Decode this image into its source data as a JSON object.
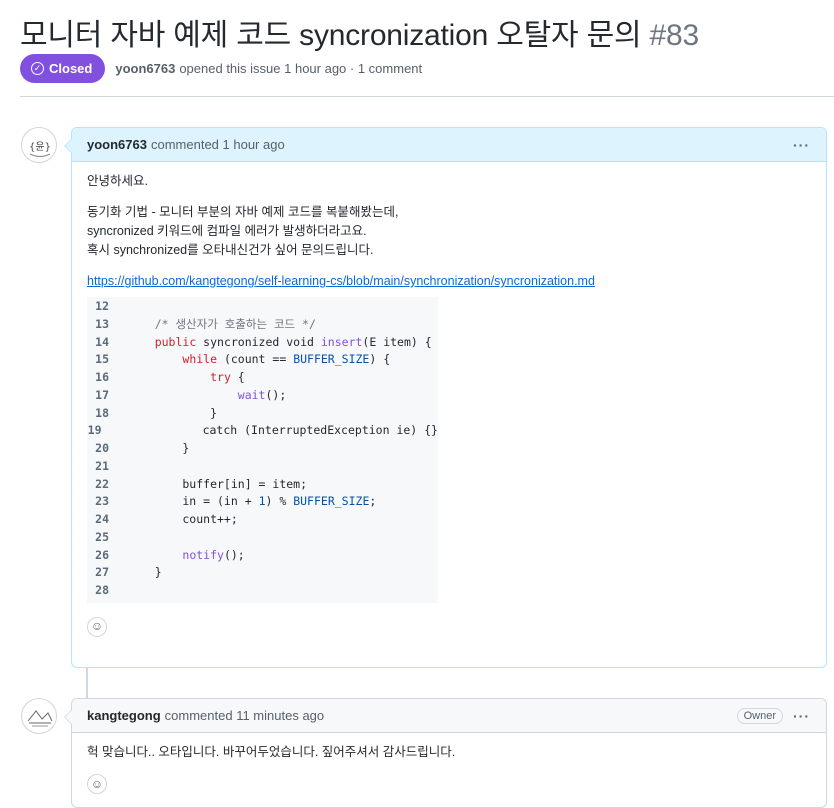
{
  "issue": {
    "title": "모니터 자바 예제 코드 syncronization 오탈자 문의",
    "number": "#83",
    "status": "Closed",
    "author": "yoon6763",
    "opened_text": "opened this issue 1 hour ago · 1 comment"
  },
  "comments": [
    {
      "author": "yoon6763",
      "time_text": "commented 1 hour ago",
      "body": {
        "greeting": "안녕하세요.",
        "para_lines": [
          "동기화 기법 - 모니터 부분의 자바 예제 코드를 복붙해봤는데,",
          "syncronized 키워드에 컴파일 에러가 발생하더라고요.",
          "혹시 synchronized를 오타내신건가 싶어 문의드립니다."
        ],
        "link": "https://github.com/kangtegong/self-learning-cs/blob/main/synchronization/syncronization.md",
        "code_lines": [
          {
            "n": "12",
            "t": ""
          },
          {
            "n": "13",
            "t": "    /* 생산자가 호출하는 코드 */"
          },
          {
            "n": "14",
            "t": "    public syncronized void insert(E item) {"
          },
          {
            "n": "15",
            "t": "        while (count == BUFFER_SIZE) {"
          },
          {
            "n": "16",
            "t": "            try {"
          },
          {
            "n": "17",
            "t": "                wait();"
          },
          {
            "n": "18",
            "t": "            }"
          },
          {
            "n": "19",
            "t": "            catch (InterruptedException ie) {}"
          },
          {
            "n": "20",
            "t": "        }"
          },
          {
            "n": "21",
            "t": ""
          },
          {
            "n": "22",
            "t": "        buffer[in] = item;"
          },
          {
            "n": "23",
            "t": "        in = (in + 1) % BUFFER_SIZE;"
          },
          {
            "n": "24",
            "t": "        count++;"
          },
          {
            "n": "25",
            "t": ""
          },
          {
            "n": "26",
            "t": "        notify();"
          },
          {
            "n": "27",
            "t": "    }"
          },
          {
            "n": "28",
            "t": ""
          }
        ]
      },
      "reaction_icon": "smiley-icon"
    },
    {
      "author": "kangtegong",
      "time_text": "commented 11 minutes ago",
      "role_badge": "Owner",
      "body_text": "헉 맞습니다.. 오타입니다. 바꾸어두었습니다. 짚어주셔서 감사드립니다."
    }
  ],
  "colors": {
    "closed_badge": "#8250df",
    "link": "#0969da",
    "author_header": "#ddf4ff"
  }
}
